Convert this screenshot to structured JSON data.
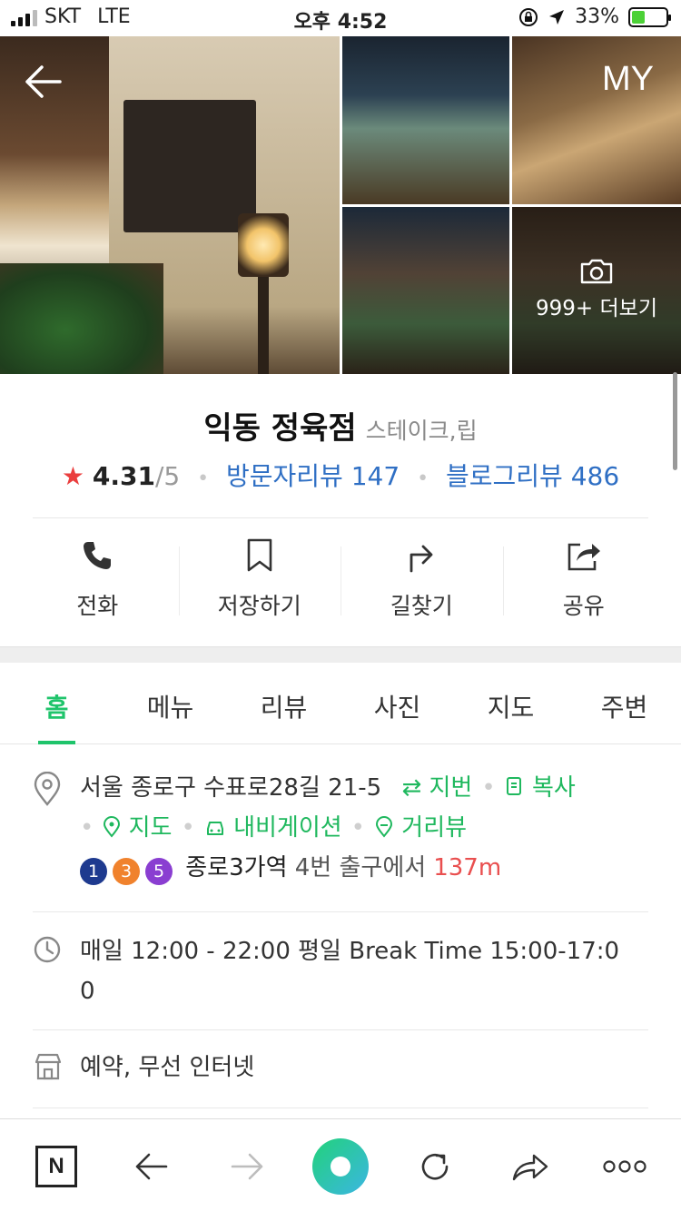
{
  "status_bar": {
    "carrier": "SKT",
    "network": "LTE",
    "time": "오후 4:52",
    "battery": "33%"
  },
  "gallery": {
    "my_label": "MY",
    "more_label": "999+ 더보기"
  },
  "place": {
    "name": "익동 정육점",
    "category": "스테이크,립",
    "rating": "4.31",
    "rating_max": "/5",
    "visitor_reviews_label": "방문자리뷰",
    "visitor_reviews_count": "147",
    "blog_reviews_label": "블로그리뷰",
    "blog_reviews_count": "486"
  },
  "actions": [
    {
      "label": "전화",
      "icon": "phone-icon"
    },
    {
      "label": "저장하기",
      "icon": "bookmark-icon"
    },
    {
      "label": "길찾기",
      "icon": "directions-icon"
    },
    {
      "label": "공유",
      "icon": "share-icon"
    }
  ],
  "tabs": [
    "홈",
    "메뉴",
    "리뷰",
    "사진",
    "지도",
    "주변"
  ],
  "active_tab": "홈",
  "info": {
    "address": "서울 종로구 수표로28길 21-5",
    "jibun_label": "지번",
    "copy_label": "복사",
    "map_label": "지도",
    "navigation_label": "내비게이션",
    "street_view_label": "거리뷰",
    "subway_lines": [
      {
        "number": "1",
        "color": "#1e3a8f"
      },
      {
        "number": "3",
        "color": "#f0822d"
      },
      {
        "number": "5",
        "color": "#8a3ed1"
      }
    ],
    "station": "종로3가역",
    "exit_text": "4번 출구에서",
    "distance": "137m",
    "hours_line1": "매일 12:00 - 22:00 평일 Break Time 15:00-17:0",
    "hours_line2": "0",
    "facilities": "예약, 무선 인터넷"
  },
  "colors": {
    "accent_green": "#1fc46b",
    "link_blue": "#2f6fc4",
    "star_red": "#ea3e3e"
  }
}
